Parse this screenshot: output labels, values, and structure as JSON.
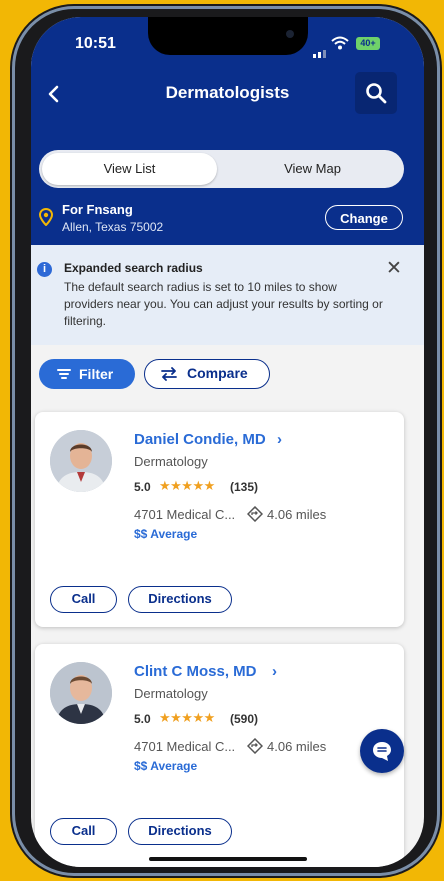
{
  "status_bar": {
    "time": "10:51",
    "battery": "40+"
  },
  "header": {
    "title": "Dermatologists"
  },
  "view_toggle": {
    "list": "View List",
    "map": "View Map"
  },
  "location": {
    "name": "For Fnsang",
    "address": "Allen, Texas 75002",
    "change_label": "Change"
  },
  "notice": {
    "title": "Expanded search radius",
    "body": "The default search radius is set to 10 miles to show providers near you. You can adjust your results by sorting or filtering."
  },
  "actions": {
    "filter_label": "Filter",
    "compare_label": "Compare"
  },
  "providers": [
    {
      "name": "Daniel Condie, MD",
      "specialty": "Dermatology",
      "rating": "5.0",
      "stars": "★★★★★",
      "reviews": "(135)",
      "address": "4701 Medical C...",
      "distance": "4.06 miles",
      "price": "$$ Average",
      "call_label": "Call",
      "directions_label": "Directions"
    },
    {
      "name": "Clint C Moss, MD",
      "specialty": "Dermatology",
      "rating": "5.0",
      "stars": "★★★★★",
      "reviews": "(590)",
      "address": "4701 Medical C...",
      "distance": "4.06 miles",
      "price": "$$ Average",
      "call_label": "Call",
      "directions_label": "Directions"
    }
  ],
  "colors": {
    "brand_navy": "#0a2f8c",
    "link_blue": "#2a6bd6",
    "star": "#f0a020",
    "frame": "#f2b705"
  },
  "icons": [
    "back-chevron-icon",
    "search-icon",
    "location-pin-icon",
    "info-icon",
    "close-icon",
    "filter-icon",
    "compare-icon",
    "directions-icon",
    "chat-icon"
  ]
}
